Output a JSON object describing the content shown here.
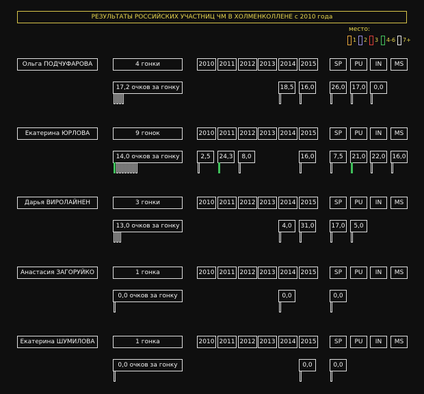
{
  "title": "РЕЗУЛЬТАТЫ РОССИЙСКИХ УЧАСТНИЦ ЧМ В ХОЛМЕНКОЛЛЕНЕ с 2010 года",
  "legend": {
    "label": "место:",
    "items": [
      {
        "text": "1",
        "color": "#e7a83c"
      },
      {
        "text": "2",
        "color": "#9a8fe0"
      },
      {
        "text": "3",
        "color": "#e0403a"
      },
      {
        "text": "4-6",
        "color": "#46c45e"
      },
      {
        "text": "7+",
        "color": "#e8e8e8"
      }
    ]
  },
  "years": [
    "2010",
    "2011",
    "2012",
    "2013",
    "2014",
    "2015"
  ],
  "disciplines": [
    "SP",
    "PU",
    "IN",
    "MS"
  ],
  "athletes": [
    {
      "name": "Ольга ПОДЧУФАРОВА",
      "races": "4 гонки",
      "avg": "17,2 очков за гонку",
      "year_values": [
        "",
        "",
        "",
        "",
        "18,5",
        "16,0"
      ],
      "disc_values": [
        "26,0",
        "17,0",
        "0,0",
        ""
      ]
    },
    {
      "name": "Екатерина ЮРЛОВА",
      "races": "9 гонок",
      "avg": "14,0 очков за гонку",
      "year_values": [
        "2,5",
        "24,3",
        "8,0",
        "",
        "",
        "16,0"
      ],
      "disc_values": [
        "7,5",
        "21,0",
        "22,0",
        "16,0"
      ]
    },
    {
      "name": "Дарья ВИРОЛАЙНЕН",
      "races": "3 гонки",
      "avg": "13,0 очков за гонку",
      "year_values": [
        "",
        "",
        "",
        "",
        "4,0",
        "31,0"
      ],
      "disc_values": [
        "17,0",
        "5,0",
        "",
        ""
      ]
    },
    {
      "name": "Анастасия ЗАГОРУЙКО",
      "races": "1 гонка",
      "avg": "0,0 очков за гонку",
      "year_values": [
        "",
        "",
        "",
        "",
        "0,0",
        ""
      ],
      "disc_values": [
        "0,0",
        "",
        "",
        ""
      ]
    },
    {
      "name": "Екатерина ШУМИЛОВА",
      "races": "1 гонка",
      "avg": "0,0 очков за гонку",
      "year_values": [
        "",
        "",
        "",
        "",
        "",
        "0,0"
      ],
      "disc_values": [
        "0,0",
        "",
        "",
        ""
      ]
    }
  ]
}
